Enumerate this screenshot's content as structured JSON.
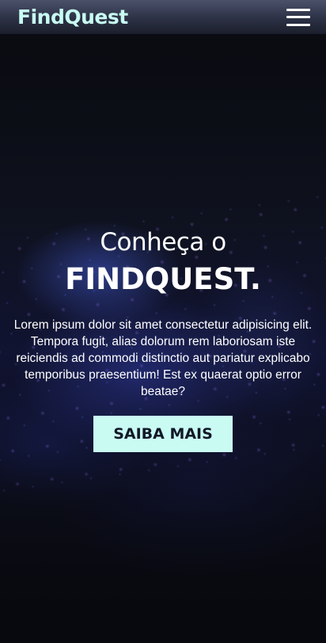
{
  "header": {
    "logo_text": "FindQuest",
    "menu_icon": "hamburger-menu-icon"
  },
  "hero": {
    "kicker": "Conheça o",
    "headline": "FINDQUEST.",
    "description": "Lorem ipsum dolor sit amet consectetur adipisicing elit. Tempora fugit, alias dolorum rem laboriosam iste reiciendis ad commodi distinctio aut pariatur explicabo temporibus praesentium! Est ex quaerat optio error beatae?",
    "cta_label": "SAIBA MAIS"
  },
  "colors": {
    "brand_accent": "#c9fbf3",
    "background": "#0a0b10",
    "header_bg": "#2c3145"
  }
}
